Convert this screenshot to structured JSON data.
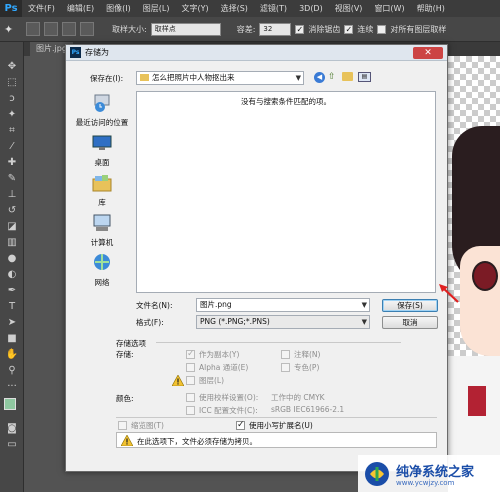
{
  "menubar": {
    "logo": "Ps",
    "items": [
      "文件(F)",
      "编辑(E)",
      "图像(I)",
      "图层(L)",
      "文字(Y)",
      "选择(S)",
      "滤镜(T)",
      "3D(D)",
      "视图(V)",
      "窗口(W)",
      "帮助(H)"
    ]
  },
  "options": {
    "sample_size_label": "取样大小:",
    "sample_size_value": "取样点",
    "tolerance_label": "容差:",
    "tolerance_value": "32",
    "antialias_label": "消除锯齿",
    "contiguous_label": "连续",
    "all_layers_label": "对所有图层取样"
  },
  "document_tab": "图片.jpg",
  "dialog": {
    "title": "存储为",
    "save_in_label": "保存在(I):",
    "save_in_value": "怎么把照片中人物抠出来",
    "empty_message": "没有与搜索条件匹配的项。",
    "places": [
      "最近访问的位置",
      "桌面",
      "库",
      "计算机",
      "网络"
    ],
    "filename_label": "文件名(N):",
    "filename_value": "图片.png",
    "format_label": "格式(F):",
    "format_value": "PNG (*.PNG;*.PNS)",
    "save_button": "保存(S)",
    "cancel_button": "取消",
    "options_title": "存储选项",
    "store_label": "存储:",
    "opt_as_copy": "作为副本(Y)",
    "opt_alpha": "Alpha 通道(E)",
    "opt_layers": "图层(L)",
    "opt_notes": "注释(N)",
    "opt_spot": "专色(P)",
    "color_label": "颜色:",
    "opt_proof": "使用校样设置(O):",
    "opt_proof_value": "工作中的 CMYK",
    "opt_icc": "ICC 配置文件(C):",
    "opt_icc_value": "sRGB IEC61966-2.1",
    "opt_thumbnail": "缩览图(T)",
    "opt_lowercase": "使用小写扩展名(U)",
    "warning_text": "在此选项下，文件必须存储为拷贝。"
  },
  "watermark": {
    "title": "纯净系统之家",
    "url": "www.ycwjzy.com"
  },
  "colors": {
    "accent_blue": "#3c7fb1",
    "arrow_red": "#e02020",
    "ps_blue": "#31a8ff"
  }
}
